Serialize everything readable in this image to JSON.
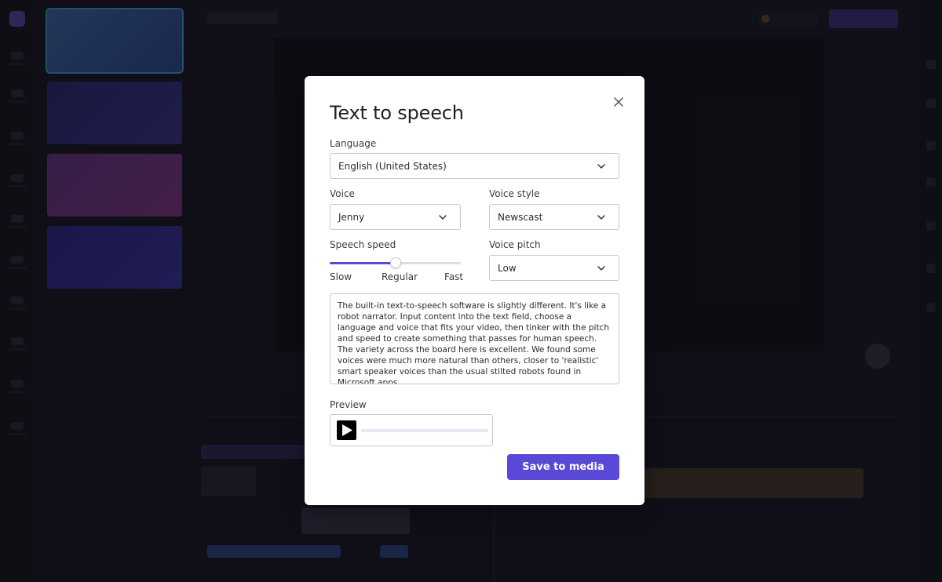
{
  "modal": {
    "title": "Text to speech",
    "language": {
      "label": "Language",
      "value": "English (United States)"
    },
    "voice": {
      "label": "Voice",
      "value": "Jenny"
    },
    "voice_style": {
      "label": "Voice style",
      "value": "Newscast"
    },
    "speech_speed": {
      "label": "Speech speed",
      "slow": "Slow",
      "regular": "Regular",
      "fast": "Fast",
      "value_fraction": 0.5
    },
    "voice_pitch": {
      "label": "Voice pitch",
      "value": "Low"
    },
    "text": "The built-in text-to-speech software is slightly different. It's like a robot narrator. Input content into the text field, choose a language and voice that fits your video, then tinker with the pitch and speed to create something that passes for human speech. The variety across the board here is excellent. We found some voices were much more natural than others, closer to 'realistic' smart speaker voices than the usual stilted robots found in Microsoft apps.",
    "preview": {
      "label": "Preview",
      "progress_fraction": 0
    },
    "save_label": "Save to media"
  },
  "colors": {
    "accent": "#5a49d6",
    "app_background": "#1b1a24"
  },
  "icons": {
    "close": "close-icon",
    "chevron": "chevron-down-icon",
    "play": "play-icon"
  }
}
